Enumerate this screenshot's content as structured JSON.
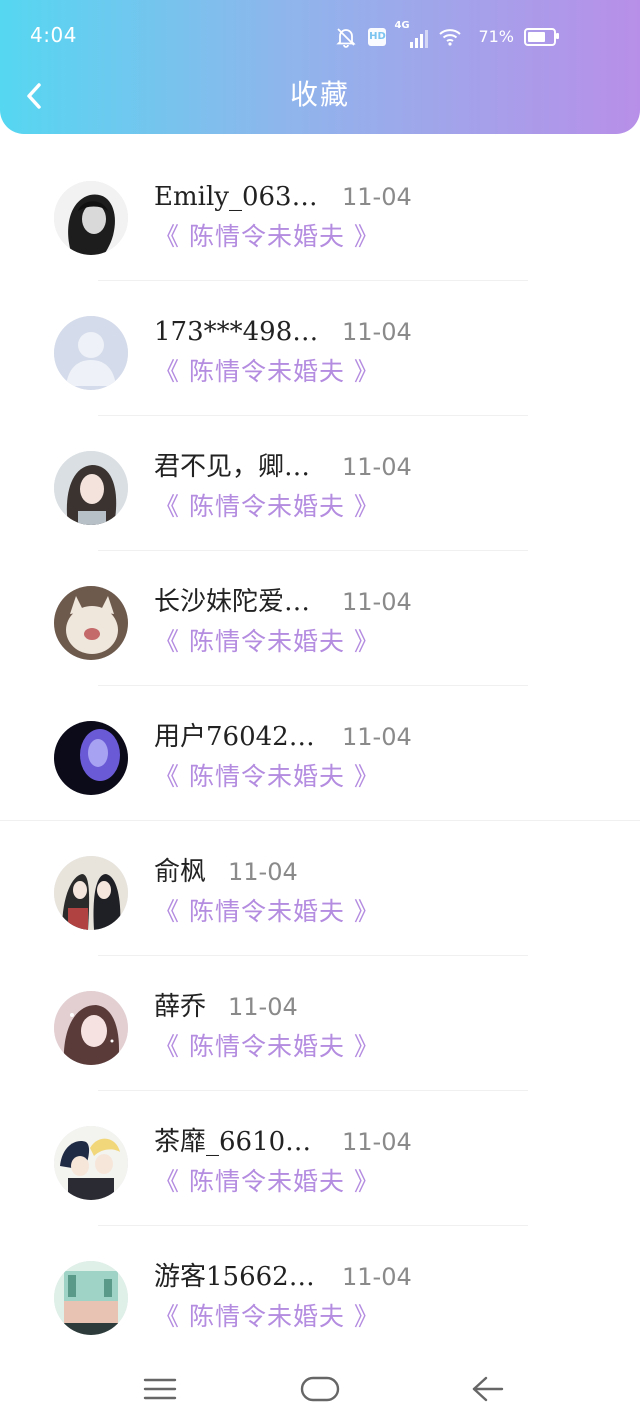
{
  "status_bar": {
    "time": "4:04",
    "hd_label": "HD",
    "network_label": "4G",
    "battery_percent": "71%"
  },
  "header": {
    "title": "收藏"
  },
  "favorites": [
    {
      "username": "Emily_063…",
      "date": "11-04",
      "novel": "《 陈情令未婚夫 》"
    },
    {
      "username": "173***498…",
      "date": "11-04",
      "novel": "《 陈情令未婚夫 》"
    },
    {
      "username": "君不见，卿…",
      "date": "11-04",
      "novel": "《 陈情令未婚夫 》"
    },
    {
      "username": "长沙妹陀爱…",
      "date": "11-04",
      "novel": "《 陈情令未婚夫 》"
    },
    {
      "username": "用户76042…",
      "date": "11-04",
      "novel": "《 陈情令未婚夫 》"
    },
    {
      "username": "俞枫",
      "date": "11-04",
      "novel": "《 陈情令未婚夫 》"
    },
    {
      "username": "薛乔",
      "date": "11-04",
      "novel": "《 陈情令未婚夫 》"
    },
    {
      "username": "茶靡_6610…",
      "date": "11-04",
      "novel": "《 陈情令未婚夫 》"
    },
    {
      "username": "游客15662…",
      "date": "11-04",
      "novel": "《 陈情令未婚夫 》"
    }
  ],
  "colors": {
    "header_gradient_start": "#55d7f1",
    "header_gradient_end": "#b88fe8",
    "novel_title": "#b48ce0",
    "date": "#8a8a8a"
  },
  "nav": {
    "menu_icon": "menu-icon",
    "home_icon": "home-icon",
    "back_icon": "back-arrow-icon"
  }
}
